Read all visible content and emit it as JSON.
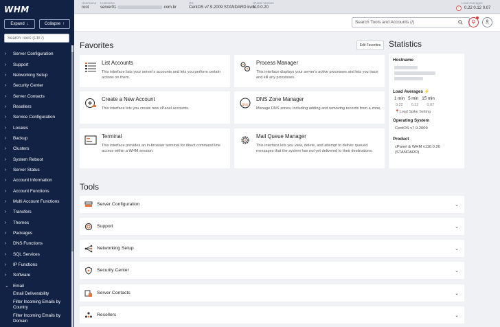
{
  "sidebar": {
    "logo": "WHM",
    "expand_label": "Expand",
    "collapse_label": "Collapse",
    "search_placeholder": "Search Tools (Ctrl /)",
    "items": [
      "Server Configuration",
      "Support",
      "Networking Setup",
      "Security Center",
      "Server Contacts",
      "Resellers",
      "Service Configuration",
      "Locales",
      "Backup",
      "Clusters",
      "System Reboot",
      "Server Status",
      "Account Information",
      "Account Functions",
      "Multi Account Functions",
      "Transfers",
      "Themes",
      "Packages",
      "DNS Functions",
      "SQL Services",
      "IP Functions",
      "Software",
      "Email"
    ],
    "email_subitems": [
      "Email Deliverability",
      "Filter Incoming Emails by Country",
      "Filter Incoming Emails by Domain"
    ]
  },
  "topbar": {
    "username_label": "Username",
    "username": "root",
    "hostname_label": "Hostname",
    "hostname_prefix": "server01.",
    "hostname_suffix": ".com.br",
    "os_label": "OS",
    "os": "CentOS v7.9.2009 STANDARD kvm",
    "cpanel_label": "cPanel Version",
    "cpanel": "110.0.20",
    "load_label": "Load Averages",
    "load": "0.22  0.12  0.07",
    "load_badge": "!"
  },
  "search": {
    "placeholder": "Search Tools and Accounts (/)"
  },
  "favorites": {
    "title": "Favorites",
    "edit_label": "Edit Favorites",
    "cards": [
      {
        "title": "List Accounts",
        "desc": "This interface lists your server's accounts and lets you perform certain actions on them."
      },
      {
        "title": "Process Manager",
        "desc": "This interface displays your server's active processes and lets you trace and kill any processes."
      },
      {
        "title": "Create a New Account",
        "desc": "This interface lets you create new cPanel accounts."
      },
      {
        "title": "DNS Zone Manager",
        "desc": "Manage DNS zones, including adding and removing records from a zone."
      },
      {
        "title": "Terminal",
        "desc": "This interface provides an in-browser terminal for direct command line access within a WHM session."
      },
      {
        "title": "Mail Queue Manager",
        "desc": "This interface lets you view, delete, and attempt to deliver queued messages that the system has not yet delivered to their destinations."
      }
    ]
  },
  "statistics": {
    "title": "Statistics",
    "hostname_label": "Hostname",
    "load_label": "Load Averages",
    "load_periods": [
      "1 min",
      "5 min",
      "15 min"
    ],
    "load_values": [
      "0.22",
      "0.12",
      "0.07"
    ],
    "load_spike": "Load Spike Setting",
    "os_label": "Operating System",
    "os_value": "CentOS v7.9.2009",
    "product_label": "Product",
    "product_value": "cPanel & WHM v110.0.20 (STANDARD)"
  },
  "tools": {
    "title": "Tools",
    "items": [
      "Server Configuration",
      "Support",
      "Networking Setup",
      "Security Center",
      "Server Contacts",
      "Resellers"
    ]
  },
  "colors": {
    "sidebar_bg": "#112244",
    "accent_orange": "#e8743b",
    "alert_red": "#d33333"
  }
}
